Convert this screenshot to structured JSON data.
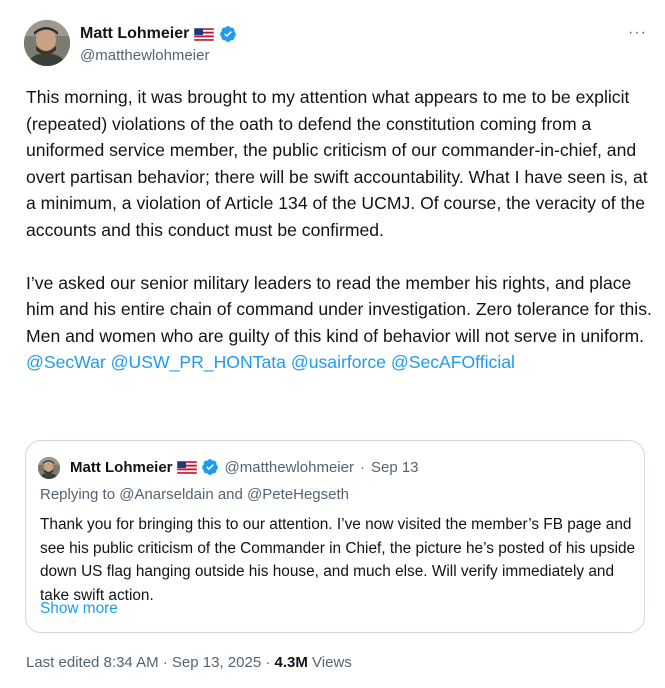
{
  "author": {
    "display_name": "Matt Lohmeier",
    "handle": "@matthewlohmeier",
    "flag_icon": "us-flag-icon",
    "verified_icon": "verified-badge-icon"
  },
  "more_menu_label": "···",
  "body": {
    "paragraph1": "This morning, it was brought to my attention what appears to me to be explicit (repeated) violations of the oath to defend the constitution coming from a uniformed service member, the public criticism of our commander-in-chief, and overt partisan behavior; there will be swift accountability. What I have seen is, at a minimum, a violation of Article 134 of the UCMJ. Of course, the veracity of the accounts and this conduct must be confirmed.",
    "paragraph2": "I’ve asked our senior military leaders to read the member his rights, and place him and his entire chain of command under investigation. Zero tolerance for this. Men and women who are guilty of this kind of behavior will not serve in uniform.",
    "mentions": [
      "@SecWar",
      "@USW_PR_HONTata",
      "@usairforce",
      "@SecAFOfficial"
    ]
  },
  "quote": {
    "display_name": "Matt Lohmeier",
    "handle": "@matthewlohmeier",
    "separator": "·",
    "date": "Sep 13",
    "replying_prefix": "Replying to ",
    "reply_user1": "@Anarseldain",
    "reply_and": " and ",
    "reply_user2": "@PeteHegseth",
    "text": "Thank you for bringing this to our attention. I’ve now visited the member’s FB page and see his public criticism of the Commander in Chief, the picture he’s posted of his upside down US flag hanging outside his house, and much else. Will verify immediately and take swift action.",
    "show_more": "Show more"
  },
  "footer": {
    "edited_label": "Last edited 8:34 AM · Sep 13, 2025",
    "separator": " · ",
    "views_count": "4.3M",
    "views_label": " Views"
  },
  "colors": {
    "link": "#1d9bf0",
    "secondary_text": "#536471",
    "primary_text": "#0f1419",
    "border": "#cfd9de"
  }
}
